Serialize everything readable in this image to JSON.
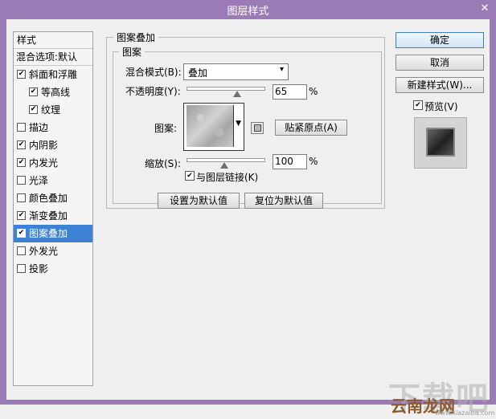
{
  "window": {
    "title": "图层样式"
  },
  "style_list": {
    "header": "样式",
    "blend_options": "混合选项:默认",
    "items": [
      {
        "label": "斜面和浮雕",
        "checked": true
      },
      {
        "label": "等高线",
        "checked": true
      },
      {
        "label": "纹理",
        "checked": true
      },
      {
        "label": "描边",
        "checked": false
      },
      {
        "label": "内阴影",
        "checked": true
      },
      {
        "label": "内发光",
        "checked": true
      },
      {
        "label": "光泽",
        "checked": false
      },
      {
        "label": "颜色叠加",
        "checked": false
      },
      {
        "label": "渐变叠加",
        "checked": true
      },
      {
        "label": "图案叠加",
        "checked": true
      },
      {
        "label": "外发光",
        "checked": false
      },
      {
        "label": "投影",
        "checked": false
      }
    ]
  },
  "panel": {
    "outer_title": "图案叠加",
    "inner_title": "图案",
    "blend_mode_label": "混合模式(B):",
    "blend_mode_value": "叠加",
    "opacity_label": "不透明度(Y):",
    "opacity_value": "65",
    "percent": "%",
    "pattern_label": "图案:",
    "snap_button": "贴紧原点(A)",
    "scale_label": "缩放(S):",
    "scale_value": "100",
    "link_label": "与图层链接(K)",
    "link_checked": true,
    "set_default_button": "设置为默认值",
    "reset_default_button": "复位为默认值"
  },
  "right": {
    "ok_button": "确定",
    "cancel_button": "取消",
    "new_style_button": "新建样式(W)...",
    "preview_label": "预览(V)",
    "preview_checked": true
  },
  "watermark": {
    "top": "下载吧",
    "brand": "云南龙网",
    "url": "www.xiazaiba.com"
  },
  "colors": {
    "titlebar": "#9b7bb6",
    "selection": "#3e82d6"
  }
}
